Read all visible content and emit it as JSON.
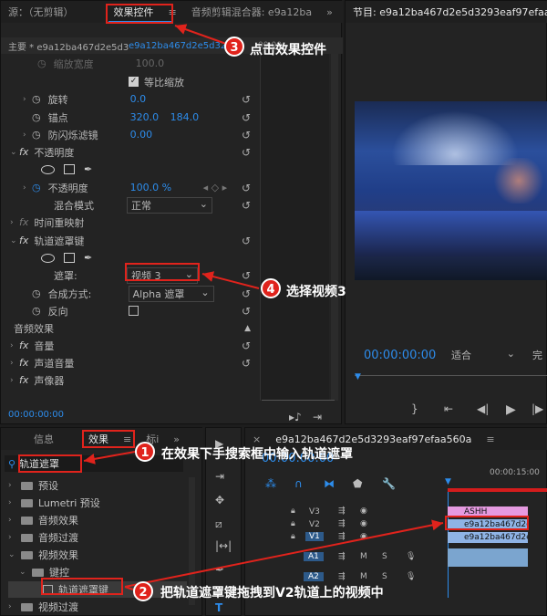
{
  "source_panel": {
    "tab_source": "源：（无剪辑）",
    "tab_effect_controls": "效果控件",
    "tab_audio_mixer": "音频剪辑混合器: e9a12ba"
  },
  "effect_controls": {
    "master_clip": "主要 * e9a12ba467d2e5d32...",
    "sequence_clip": "e9a12ba467d2e5d32...",
    "time_marker": "00:00",
    "rows": {
      "scale_width": "缩放宽度",
      "scale_width_value": "100.0",
      "uniform_scale": "等比缩放",
      "rotation": "旋转",
      "rotation_value": "0.0",
      "anchor": "锚点",
      "anchor_x": "320.0",
      "anchor_y": "184.0",
      "flicker": "防闪烁滤镜",
      "flicker_value": "0.00",
      "opacity_group": "不透明度",
      "opacity": "不透明度",
      "opacity_value": "100.0 %",
      "blend_mode": "混合模式",
      "blend_mode_value": "正常",
      "time_remap": "时间重映射",
      "track_matte": "轨道遮罩键",
      "matte": "遮罩:",
      "matte_value": "视频 3",
      "composite": "合成方式:",
      "composite_value": "Alpha 遮罩",
      "reverse": "反向",
      "audio_effects": "音频效果",
      "volume": "音量",
      "channel_volume": "声道音量",
      "panner": "声像器"
    },
    "timecode": "00:00:00:00"
  },
  "program_monitor": {
    "title": "节目: e9a12ba467d2e5d3293eaf97efaa560a",
    "timecode": "00:00:00:00",
    "fit": "适合",
    "quality": "完"
  },
  "effects_panel": {
    "tab_info": "信息",
    "tab_effects": "效果",
    "tab_markers": "标i",
    "search_value": "轨道遮罩",
    "tree": [
      "预设",
      "Lumetri 预设",
      "音频效果",
      "音频过渡",
      "视频效果",
      "键控",
      "轨道遮罩键",
      "视频过渡"
    ]
  },
  "timeline": {
    "title": "e9a12ba467d2e5d3293eaf97efaa560a",
    "timecode": "00:00:00:00",
    "ruler": "00:00:15:00",
    "tracks": [
      "V3",
      "V2",
      "V1",
      "A1",
      "A2"
    ],
    "clip_v3": "ASHH",
    "clip_v2": "e9a12ba467d2e5",
    "clip_v1": "e9a12ba467d2e5",
    "m_label": "M",
    "s_label": "S"
  },
  "callouts": {
    "c1_num": "1",
    "c1_text": "在效果下手搜索框中输入轨道遮罩",
    "c2_num": "2",
    "c2_text": "把轨道遮罩键拖拽到V2轨道上的视频中",
    "c3_num": "3",
    "c3_text": "点击效果控件",
    "c4_num": "4",
    "c4_text": "选择视频3"
  },
  "colors": {
    "accent_blue": "#2d8ceb",
    "annotation_red": "#e0231c",
    "clip_pink": "#e59ae0",
    "clip_blue": "#8fb4e6"
  }
}
